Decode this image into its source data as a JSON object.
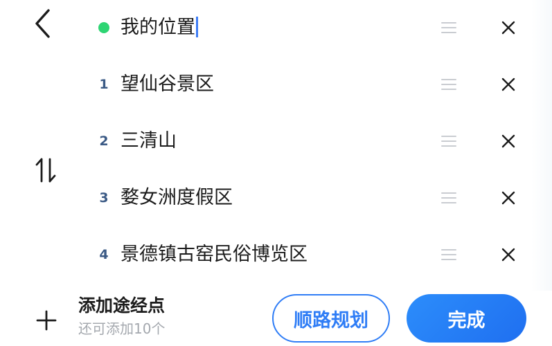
{
  "header": {
    "back_icon": "chevron-left-icon",
    "swap_icon": "swap-vertical-icon"
  },
  "stops": [
    {
      "marker": "dot",
      "marker_color": "#2ed573",
      "name": "我的位置",
      "editing": true
    },
    {
      "marker": "1",
      "name": "望仙谷景区"
    },
    {
      "marker": "2",
      "name": "三清山"
    },
    {
      "marker": "3",
      "name": "婺女洲度假区"
    },
    {
      "marker": "4",
      "name": "景德镇古窑民俗博览区"
    }
  ],
  "footer": {
    "add_icon": "plus-icon",
    "add_label": "添加途经点",
    "add_sub": "还可添加10个",
    "route_button": "顺路规划",
    "done_button": "完成"
  },
  "colors": {
    "accent": "#2f7df6",
    "stop_number": "#3b5a85",
    "current_location_dot": "#2ed573"
  }
}
